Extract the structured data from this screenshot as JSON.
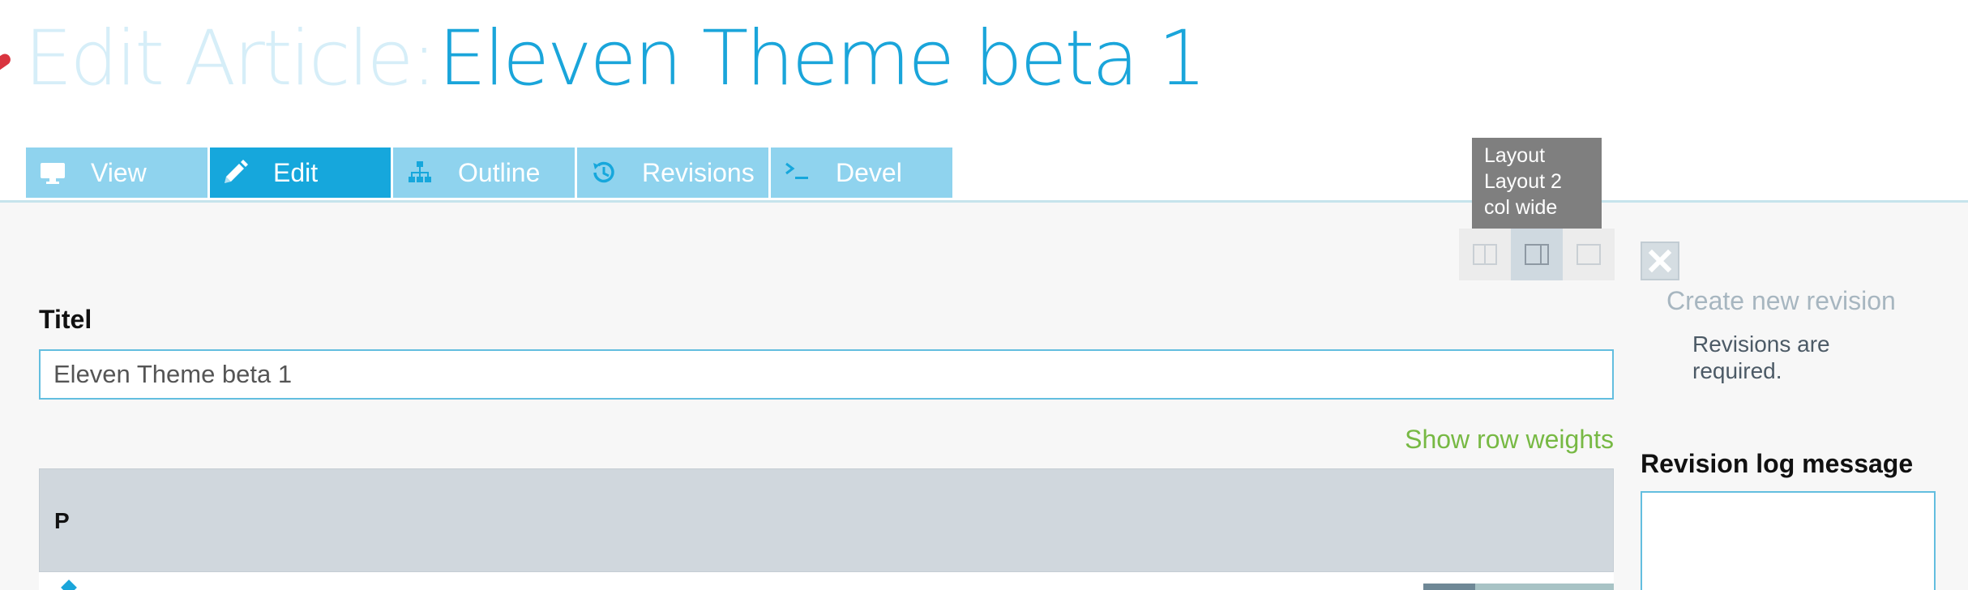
{
  "header": {
    "title_prefix": "Edit Article:",
    "title_name": "Eleven Theme beta 1"
  },
  "tabs": [
    {
      "label": "View",
      "icon": "monitor-icon",
      "active": false
    },
    {
      "label": "Edit",
      "icon": "pencil-icon",
      "active": true
    },
    {
      "label": "Outline",
      "icon": "sitemap-icon",
      "active": false
    },
    {
      "label": "Revisions",
      "icon": "history-icon",
      "active": false
    },
    {
      "label": "Devel",
      "icon": "terminal-icon",
      "active": false
    }
  ],
  "tooltip": {
    "line1": "Layout",
    "line2": "Layout 2",
    "line3": "col wide"
  },
  "layout_switch": {
    "options": [
      "layout-2-col-icon",
      "layout-2-col-wide-icon",
      "layout-1-col-icon"
    ],
    "active_index": 1
  },
  "form": {
    "title_label": "Titel",
    "title_value": "Eleven Theme beta 1",
    "show_row_weights": "Show row weights",
    "paragraphs_header": "P"
  },
  "sidebar": {
    "create_new_revision": "Create new revision",
    "revisions_required": "Revisions are required.",
    "revision_log_label": "Revision log message",
    "revision_log_value": ""
  },
  "colors": {
    "accent": "#16a7dc",
    "tab_inactive": "#8fd3ee",
    "title_prefix": "#d6eef8",
    "link_green": "#77b944",
    "tooltip_bg": "#7f7f7f"
  }
}
